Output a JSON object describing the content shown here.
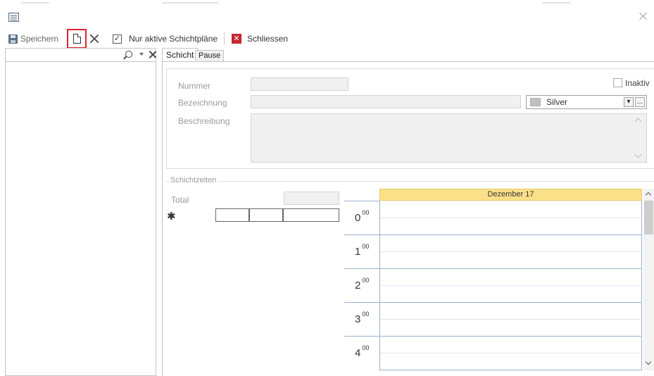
{
  "toolbar": {
    "save_label": "Speichern",
    "active_only_label": "Nur aktive Schichtpläne",
    "active_only_checked": true,
    "close_label": "Schliessen"
  },
  "tabs": [
    {
      "label": "Schicht",
      "active": true
    },
    {
      "label": "Pause",
      "active": false
    }
  ],
  "form": {
    "nummer_label": "Nummer",
    "bezeichnung_label": "Bezeichnung",
    "beschreibung_label": "Beschreibung",
    "inaktiv_label": "Inaktiv",
    "inaktiv_checked": false,
    "color_value": "Silver",
    "color_swatch": "#c0c0c0",
    "color_more_label": "..."
  },
  "schichtzeiten": {
    "group_label": "Schichtzeiten",
    "total_label": "Total",
    "new_row_symbol": "✱"
  },
  "schedule": {
    "date_header": "Dezember 17",
    "header_color": "#fbe08a",
    "hours": [
      {
        "hour": "0",
        "minutes": "00"
      },
      {
        "hour": "1",
        "minutes": "00"
      },
      {
        "hour": "2",
        "minutes": "00"
      },
      {
        "hour": "3",
        "minutes": "00"
      },
      {
        "hour": "4",
        "minutes": "00"
      }
    ]
  },
  "icons": {
    "app": "app-window-icon",
    "save": "floppy-disk-icon",
    "new": "new-document-icon",
    "delete": "delete-x-icon",
    "close": "red-close-icon",
    "search": "magnifier-icon"
  },
  "colors": {
    "highlight": "#d9262b",
    "close_red": "#c7262c",
    "grid_blue": "#9ab3d1"
  }
}
